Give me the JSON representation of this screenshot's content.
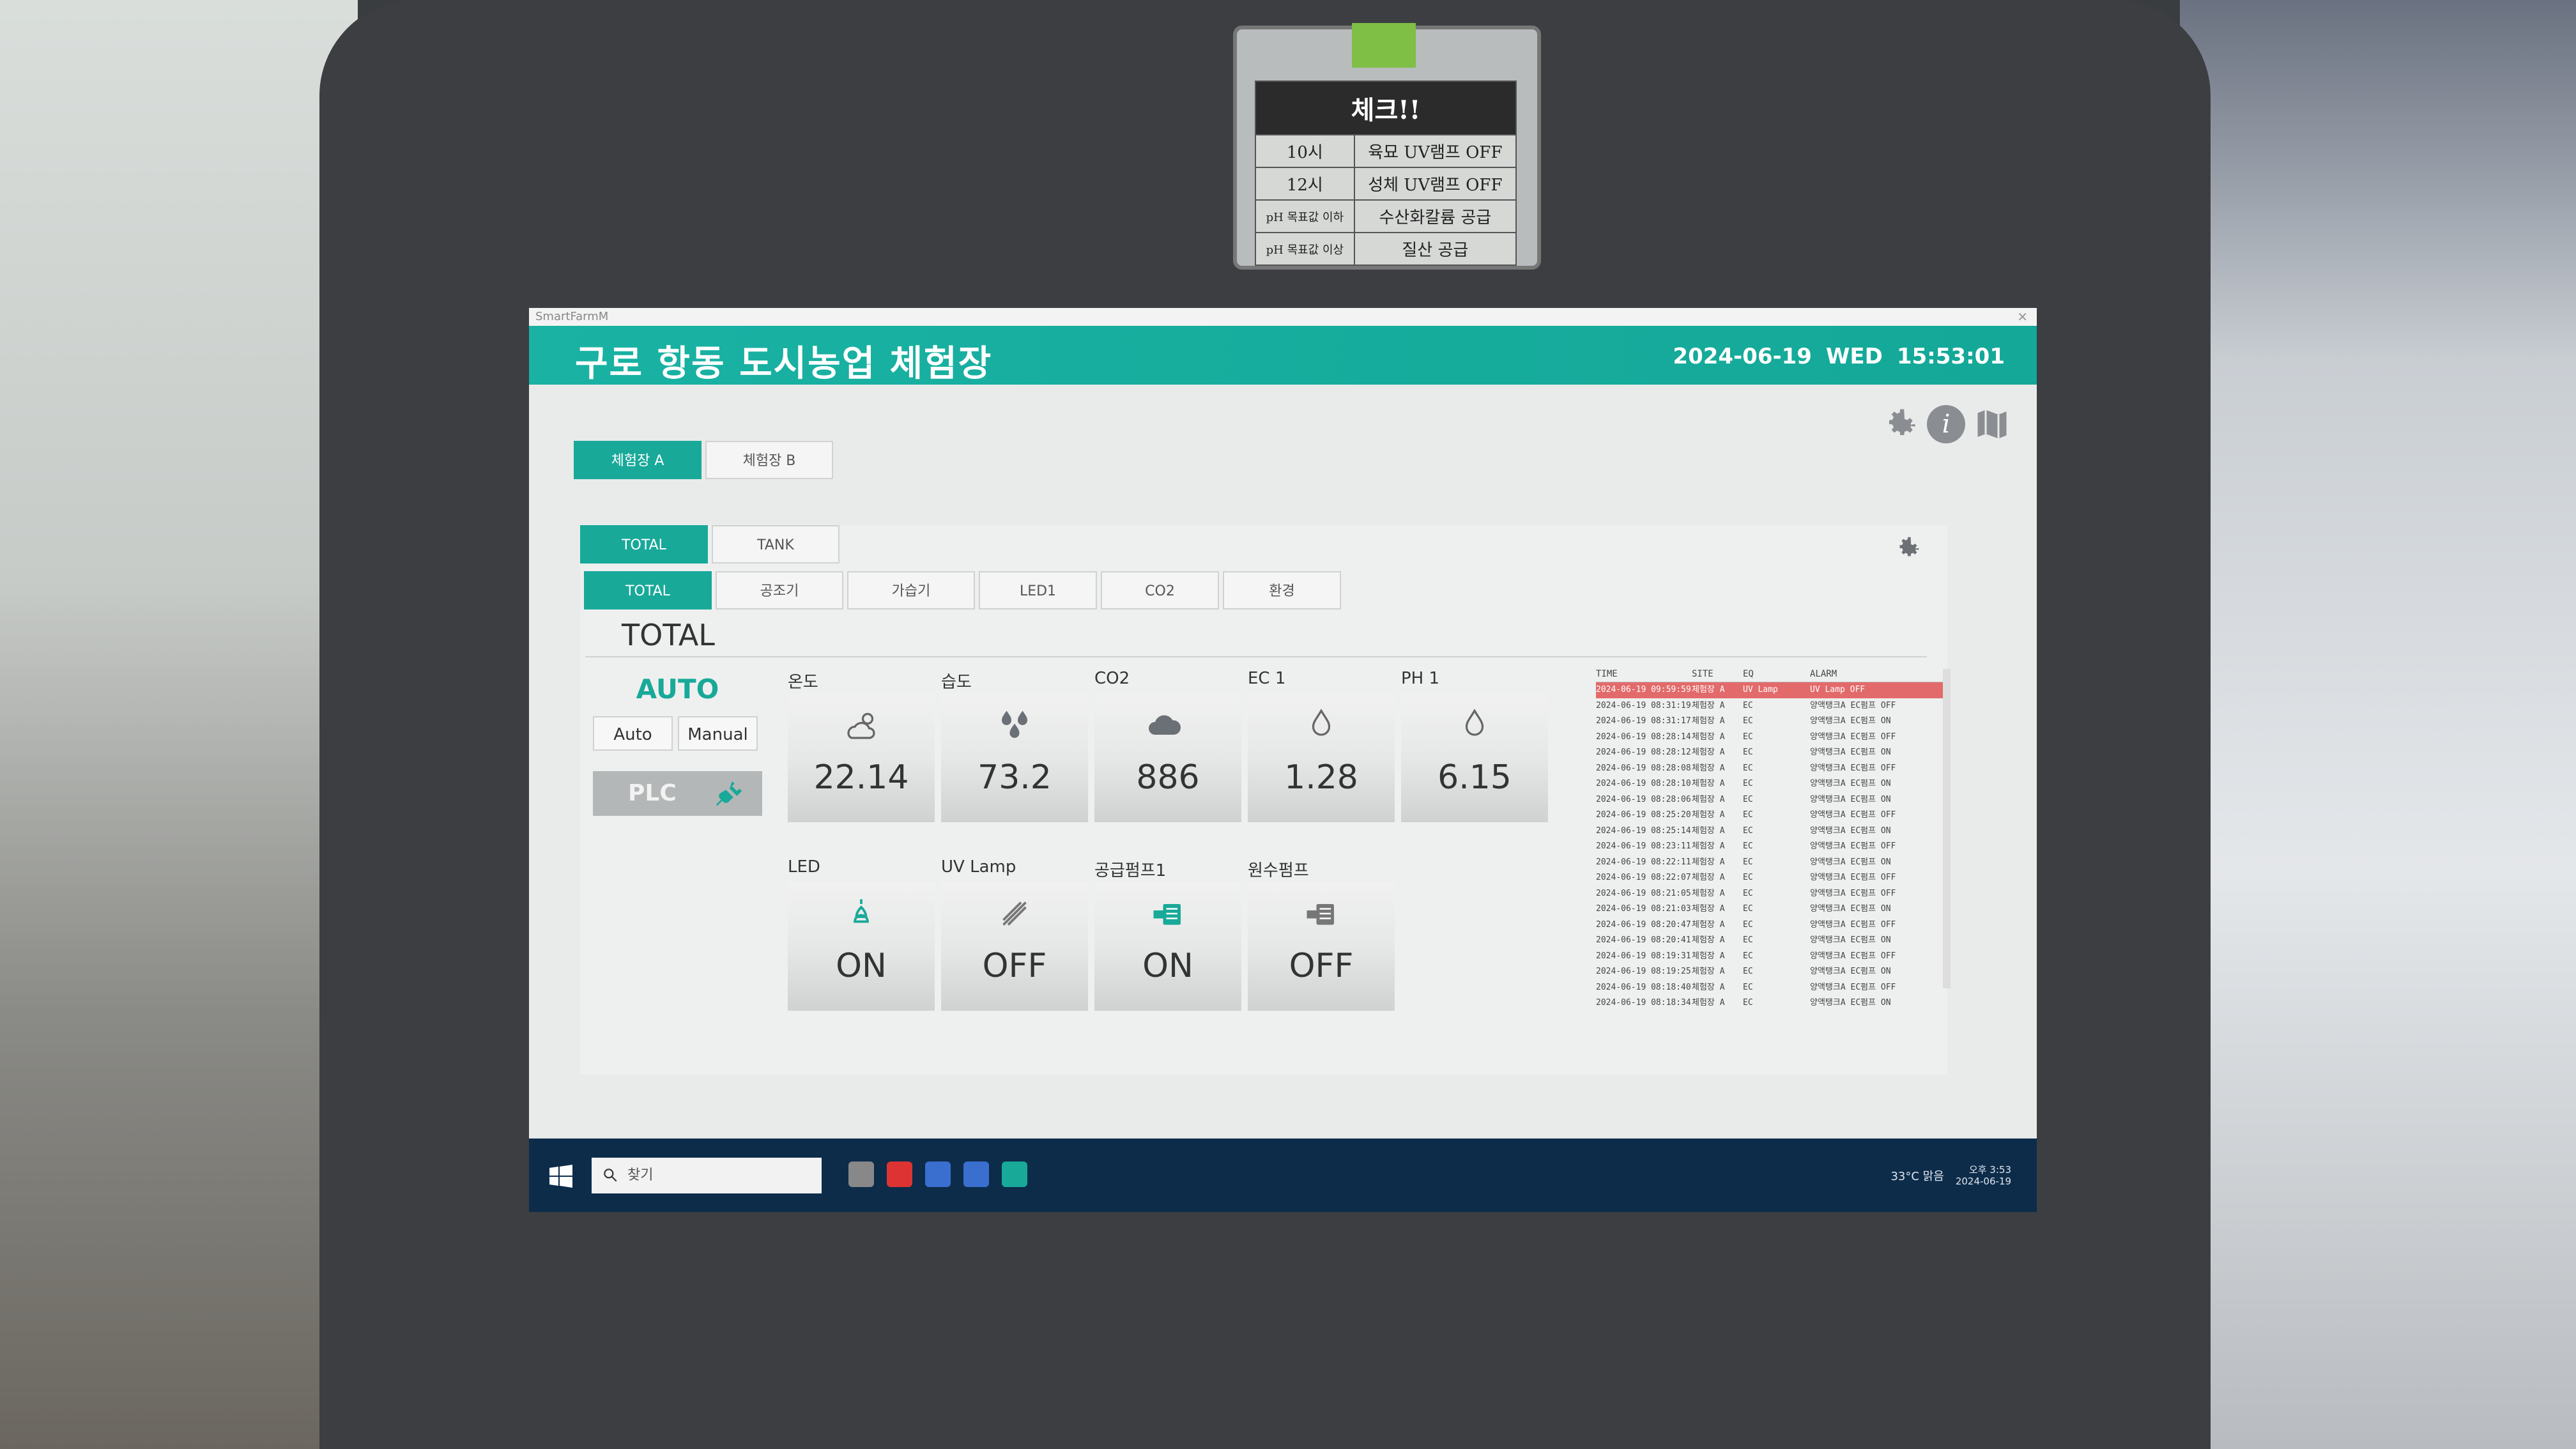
{
  "sign": {
    "title": "체크!!",
    "rows": [
      {
        "when": "10시",
        "what": "육묘 UV램프 OFF"
      },
      {
        "when": "12시",
        "what": "성체 UV램프 OFF"
      },
      {
        "when": "pH 목표값 이하",
        "what": "수산화칼륨 공급"
      },
      {
        "when": "pH 목표값 이상",
        "what": "질산 공급"
      }
    ]
  },
  "window": {
    "title": "SmartFarmM",
    "close": "✕"
  },
  "header": {
    "title": "구로 항동 도시농업 체험장",
    "date": "2024-06-19",
    "day": "WED",
    "time": "15:53:01"
  },
  "icons": {
    "info": "i"
  },
  "site_tabs": [
    "체험장 A",
    "체험장 B"
  ],
  "view_tabs": [
    "TOTAL",
    "TANK"
  ],
  "sub_tabs": [
    "TOTAL",
    "공조기",
    "가습기",
    "LED1",
    "CO2",
    "환경"
  ],
  "section_title": "TOTAL",
  "mode": {
    "state": "AUTO",
    "auto_label": "Auto",
    "manual_label": "Manual",
    "plc_label": "PLC"
  },
  "sensors": [
    {
      "label": "온도",
      "value": "22.14",
      "icon": "cloud-sun-icon"
    },
    {
      "label": "습도",
      "value": "73.2",
      "icon": "water-drops-icon"
    },
    {
      "label": "CO2",
      "value": "886",
      "icon": "co2-cloud-icon"
    },
    {
      "label": "EC 1",
      "value": "1.28",
      "icon": "ec-drop-icon"
    },
    {
      "label": "PH 1",
      "value": "6.15",
      "icon": "ph-drop-icon"
    }
  ],
  "devices": [
    {
      "label": "LED",
      "value": "ON",
      "icon": "lamp-icon"
    },
    {
      "label": "UV Lamp",
      "value": "OFF",
      "icon": "uv-lamp-icon"
    },
    {
      "label": "공급펌프1",
      "value": "ON",
      "icon": "pump-icon"
    },
    {
      "label": "원수펌프",
      "value": "OFF",
      "icon": "pump-icon"
    }
  ],
  "alarm": {
    "headers": [
      "TIME",
      "SITE",
      "EQ",
      "ALARM"
    ],
    "rows": [
      [
        "2024-06-19 09:59:59",
        "체험장 A",
        "UV Lamp",
        "UV Lamp OFF"
      ],
      [
        "2024-06-19 08:31:19",
        "체험장 A",
        "EC",
        "양액탱크A EC펌프 OFF"
      ],
      [
        "2024-06-19 08:31:17",
        "체험장 A",
        "EC",
        "양액탱크A EC펌프 ON"
      ],
      [
        "2024-06-19 08:28:14",
        "체험장 A",
        "EC",
        "양액탱크A EC펌프 OFF"
      ],
      [
        "2024-06-19 08:28:12",
        "체험장 A",
        "EC",
        "양액탱크A EC펌프 ON"
      ],
      [
        "2024-06-19 08:28:08",
        "체험장 A",
        "EC",
        "양액탱크A EC펌프 OFF"
      ],
      [
        "2024-06-19 08:28:10",
        "체험장 A",
        "EC",
        "양액탱크A EC펌프 ON"
      ],
      [
        "2024-06-19 08:28:06",
        "체험장 A",
        "EC",
        "양액탱크A EC펌프 ON"
      ],
      [
        "2024-06-19 08:25:20",
        "체험장 A",
        "EC",
        "양액탱크A EC펌프 OFF"
      ],
      [
        "2024-06-19 08:25:14",
        "체험장 A",
        "EC",
        "양액탱크A EC펌프 ON"
      ],
      [
        "2024-06-19 08:23:11",
        "체험장 A",
        "EC",
        "양액탱크A EC펌프 OFF"
      ],
      [
        "2024-06-19 08:22:11",
        "체험장 A",
        "EC",
        "양액탱크A EC펌프 ON"
      ],
      [
        "2024-06-19 08:22:07",
        "체험장 A",
        "EC",
        "양액탱크A EC펌프 OFF"
      ],
      [
        "2024-06-19 08:21:05",
        "체험장 A",
        "EC",
        "양액탱크A EC펌프 OFF"
      ],
      [
        "2024-06-19 08:21:03",
        "체험장 A",
        "EC",
        "양액탱크A EC펌프 ON"
      ],
      [
        "2024-06-19 08:20:47",
        "체험장 A",
        "EC",
        "양액탱크A EC펌프 OFF"
      ],
      [
        "2024-06-19 08:20:41",
        "체험장 A",
        "EC",
        "양액탱크A EC펌프 ON"
      ],
      [
        "2024-06-19 08:19:31",
        "체험장 A",
        "EC",
        "양액탱크A EC펌프 OFF"
      ],
      [
        "2024-06-19 08:19:25",
        "체험장 A",
        "EC",
        "양액탱크A EC펌프 ON"
      ],
      [
        "2024-06-19 08:18:40",
        "체험장 A",
        "EC",
        "양액탱크A EC펌프 OFF"
      ],
      [
        "2024-06-19 08:18:34",
        "체험장 A",
        "EC",
        "양액탱크A EC펌프 ON"
      ]
    ]
  },
  "taskbar": {
    "search_placeholder": "찾기",
    "weather": "33°C 맑음",
    "time": "오후 3:53",
    "date": "2024-06-19"
  },
  "colors": {
    "accent": "#18a999",
    "alarm_highlight": "#e36a6a",
    "taskbar": "#0d2c4a"
  }
}
